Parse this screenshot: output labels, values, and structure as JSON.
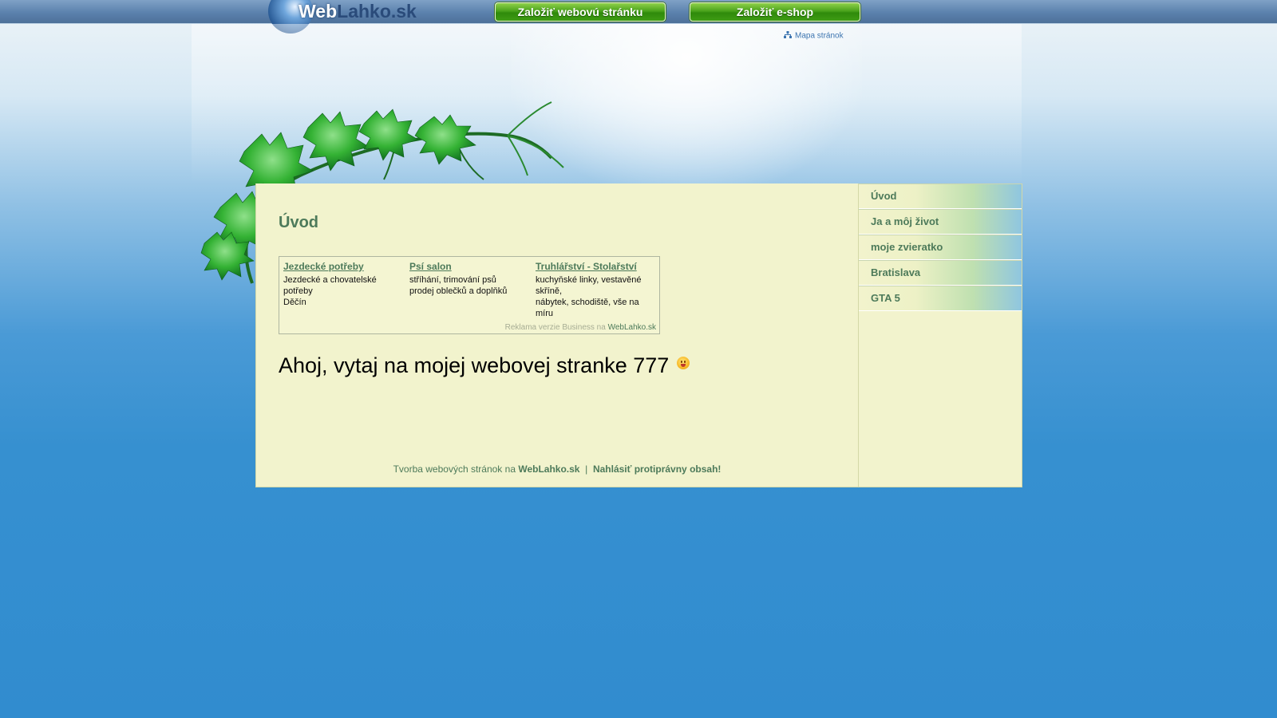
{
  "header": {
    "logo": {
      "part1": "Web",
      "part2": "Lahko.sk"
    },
    "buttons": {
      "create_site": "Založiť webovú stránku",
      "create_eshop": "Založiť e-shop"
    },
    "sitemap_label": "Mapa stránok"
  },
  "main": {
    "title": "Úvod",
    "ads": [
      {
        "title": "Jezdecké potřeby",
        "line1": "Jezdecké a chovatelské potřeby",
        "line2": "Děčín"
      },
      {
        "title": "Psí salon",
        "line1": "stříhání, trimování psů",
        "line2": "prodej oblečků a doplňků"
      },
      {
        "title": "Truhlářství - Stolařství",
        "line1": "kuchyňské linky, vestavěné skříně,",
        "line2": "nábytek, schodiště, vše na míru"
      }
    ],
    "ads_footer": {
      "text": "Reklama verzie Business na",
      "link": "WebLahko.sk"
    },
    "greeting": "Ahoj, vytaj na mojej webovej stranke 777"
  },
  "footer": {
    "text": "Tvorba webových stránok na",
    "link_site": "WebLahko.sk",
    "separator": "|",
    "report": "Nahlásiť protiprávny obsah!"
  },
  "sidebar": {
    "items": [
      {
        "label": "Úvod"
      },
      {
        "label": "Ja a môj život"
      },
      {
        "label": "moje zvieratko"
      },
      {
        "label": "Bratislava"
      },
      {
        "label": "GTA 5"
      }
    ]
  },
  "colors": {
    "accent_green": "#4d7a5a",
    "panel_bg": "#f2f3cd",
    "page_blue": "#318ccf"
  }
}
